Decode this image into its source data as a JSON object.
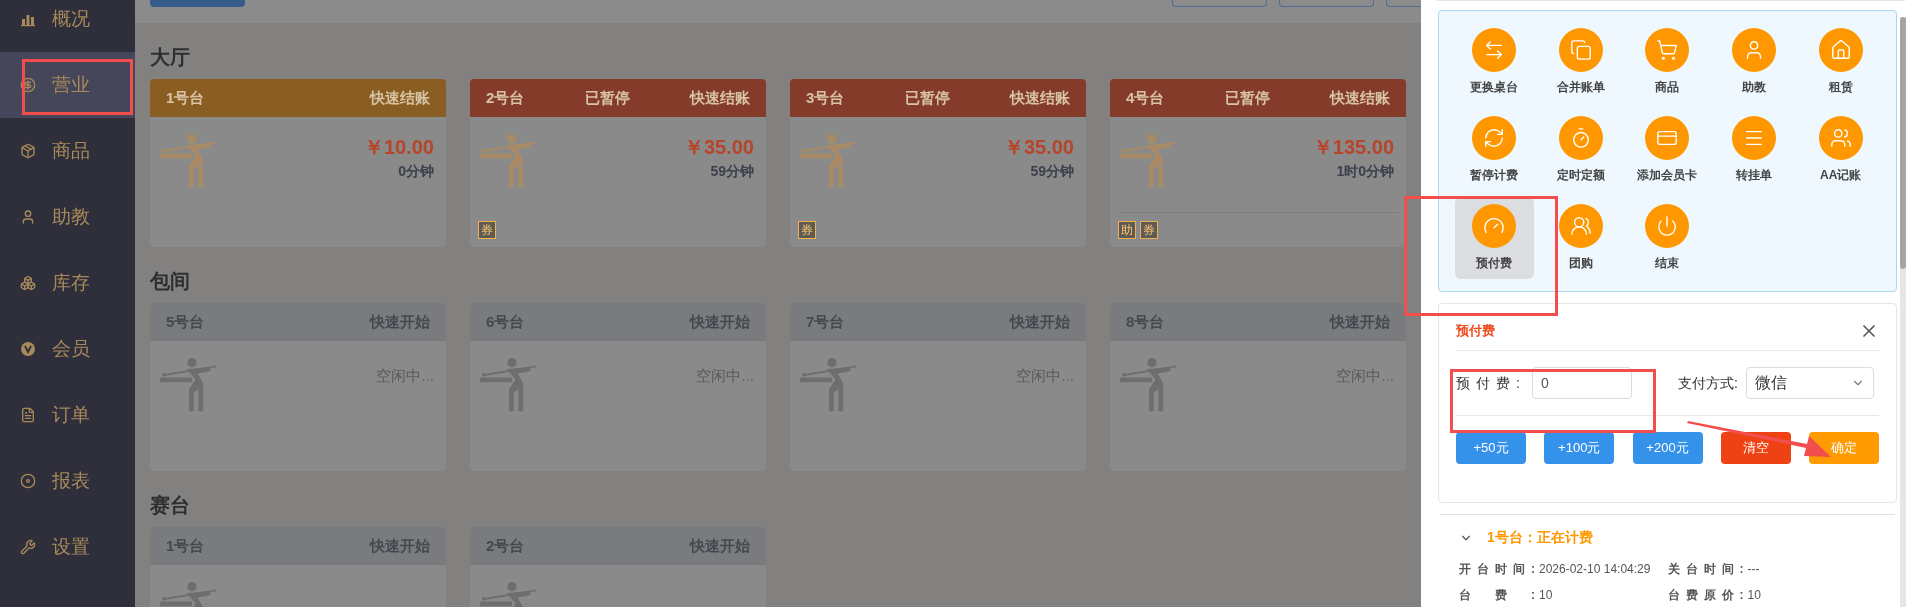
{
  "sidebar": {
    "items": [
      {
        "label": "概况",
        "selected": false
      },
      {
        "label": "营业",
        "selected": true
      },
      {
        "label": "商品",
        "selected": false
      },
      {
        "label": "助教",
        "selected": false
      },
      {
        "label": "库存",
        "selected": false
      },
      {
        "label": "会员",
        "selected": false
      },
      {
        "label": "订单",
        "selected": false
      },
      {
        "label": "报表",
        "selected": false
      },
      {
        "label": "设置",
        "selected": false
      }
    ]
  },
  "sections": [
    {
      "title": "大厅",
      "tables": [
        {
          "kind": "running",
          "name": "1号台",
          "action": "快速结账",
          "price": "￥10.00",
          "duration": "0分钟"
        },
        {
          "kind": "paused",
          "name": "2号台",
          "status": "已暂停",
          "action": "快速结账",
          "price": "￥35.00",
          "duration": "59分钟",
          "badges": [
            "券"
          ]
        },
        {
          "kind": "paused",
          "name": "3号台",
          "status": "已暂停",
          "action": "快速结账",
          "price": "￥35.00",
          "duration": "59分钟",
          "badges": [
            "券"
          ]
        },
        {
          "kind": "paused",
          "name": "4号台",
          "status": "已暂停",
          "action": "快速结账",
          "price": "￥135.00",
          "duration": "1时0分钟",
          "badges": [
            "助",
            "券"
          ]
        }
      ]
    },
    {
      "title": "包间",
      "tables": [
        {
          "kind": "idle",
          "name": "5号台",
          "action": "快速开始",
          "state_text": "空闲中..."
        },
        {
          "kind": "idle",
          "name": "6号台",
          "action": "快速开始",
          "state_text": "空闲中..."
        },
        {
          "kind": "idle",
          "name": "7号台",
          "action": "快速开始",
          "state_text": "空闲中..."
        },
        {
          "kind": "idle",
          "name": "8号台",
          "action": "快速开始",
          "state_text": "空闲中..."
        }
      ]
    },
    {
      "title": "赛台",
      "tables": [
        {
          "kind": "idle",
          "name": "1号台",
          "action": "快速开始"
        },
        {
          "kind": "idle",
          "name": "2号台",
          "action": "快速开始"
        }
      ]
    }
  ],
  "drawer": {
    "actions": [
      {
        "label": "更换桌台",
        "selected": false
      },
      {
        "label": "合并账单",
        "selected": false
      },
      {
        "label": "商品",
        "selected": false
      },
      {
        "label": "助教",
        "selected": false
      },
      {
        "label": "租赁",
        "selected": false
      },
      {
        "label": "暂停计费",
        "selected": false
      },
      {
        "label": "定时定额",
        "selected": false
      },
      {
        "label": "添加会员卡",
        "selected": false
      },
      {
        "label": "转挂单",
        "selected": false
      },
      {
        "label": "AA记账",
        "selected": false
      },
      {
        "label": "预付费",
        "selected": true
      },
      {
        "label": "团购",
        "selected": false
      },
      {
        "label": "结束",
        "selected": false
      }
    ],
    "prepay": {
      "title": "预付费",
      "amount_label": "预付费:",
      "amount_value": "0",
      "method_label": "支付方式:",
      "method_value": "微信",
      "buttons": [
        {
          "label": "+50元",
          "kind": "preset"
        },
        {
          "label": "+100元",
          "kind": "preset"
        },
        {
          "label": "+200元",
          "kind": "preset"
        },
        {
          "label": "清空",
          "kind": "clear"
        },
        {
          "label": "确定",
          "kind": "confirm"
        }
      ]
    },
    "table_info": {
      "title": "1号台：正在计费",
      "expanded": true,
      "rows": [
        [
          {
            "label": "开台时间:",
            "value": "2026-02-10 14:04:29"
          },
          {
            "label": "关台时间:",
            "value": "---"
          }
        ],
        [
          {
            "label": "台费:",
            "value": "10"
          },
          {
            "label": "台费原价:",
            "value": "10"
          }
        ]
      ]
    }
  }
}
